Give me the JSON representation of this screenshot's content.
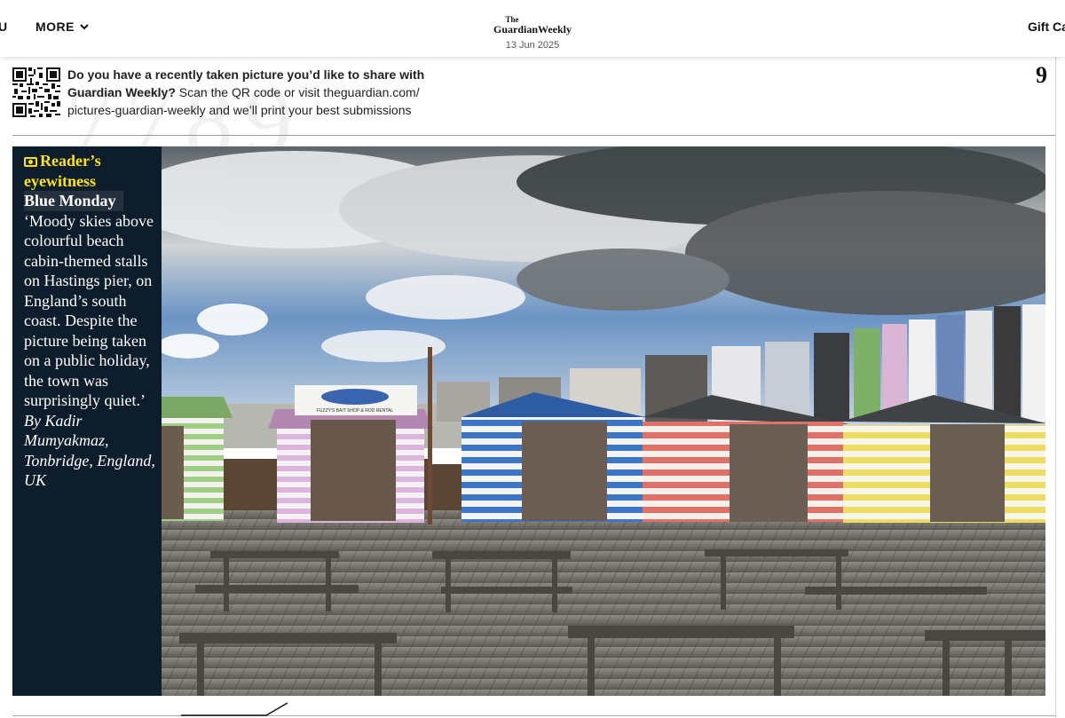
{
  "nav": {
    "left_partial": "U",
    "more_label": "MORE",
    "brand_top": "The",
    "brand_name": "GuardianWeekly",
    "date": "13 Jun 2025",
    "gift_label": "Gift Ca"
  },
  "submission": {
    "bold_text": "Do you have a recently taken picture you’d like to share with Guardian Weekly?",
    "body_text": " Scan the QR code or visit theguardian.com/ pictures-guardian-weekly and we’ll print your best submissions"
  },
  "page_number": "9",
  "caption": {
    "kicker": "Reader’s eyewitness",
    "headline": "Blue Monday",
    "body": "‘Moody skies above colourful beach cabin-themed stalls on Hastings pier, on England’s south coast. Despite the picture being taken on a public holiday, the town was surprisingly quiet.’",
    "byline": "By Kadir Mumyakmaz, Tonbridge, England, UK"
  },
  "photo": {
    "sign_text": "FUZZY'S BAIT SHOP & ROD RENTAL"
  },
  "colors": {
    "caption_bg": "#0d1d2b",
    "kicker": "#ffe500",
    "hut_green": "#9fcf83",
    "hut_pink": "#dcb5dc",
    "hut_blue": "#3d76c4",
    "hut_red": "#e0706a",
    "hut_yellow": "#eedc62"
  }
}
